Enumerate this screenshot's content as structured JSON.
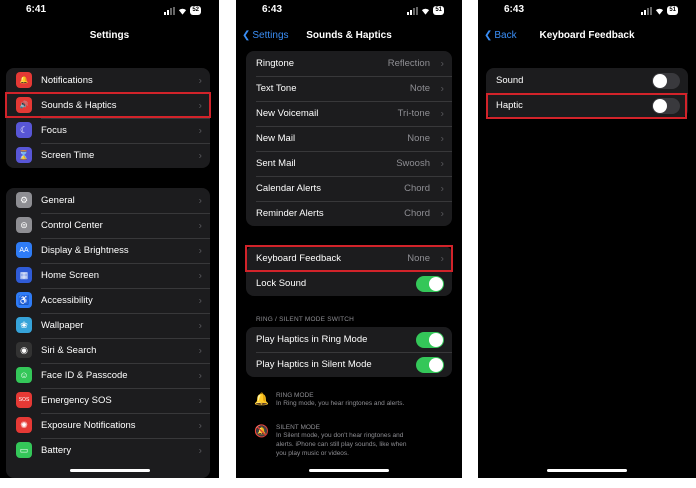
{
  "panel1": {
    "time": "6:41",
    "battery": "52",
    "title": "Settings",
    "group1": [
      {
        "label": "Notifications",
        "icon": "bell-icon",
        "color": "#e53935",
        "glyph": "🔔"
      },
      {
        "label": "Sounds & Haptics",
        "icon": "speaker-icon",
        "color": "#e53935",
        "glyph": "🔊"
      },
      {
        "label": "Focus",
        "icon": "moon-icon",
        "color": "#5856d6",
        "glyph": "☾"
      },
      {
        "label": "Screen Time",
        "icon": "hourglass-icon",
        "color": "#5856d6",
        "glyph": "⌛"
      }
    ],
    "group2": [
      {
        "label": "General",
        "icon": "gear-icon",
        "color": "#8e8e93",
        "glyph": "⚙"
      },
      {
        "label": "Control Center",
        "icon": "toggles-icon",
        "color": "#8e8e93",
        "glyph": "⊜"
      },
      {
        "label": "Display & Brightness",
        "icon": "display-icon",
        "color": "#2f7cf6",
        "glyph": "AA"
      },
      {
        "label": "Home Screen",
        "icon": "home-screen-icon",
        "color": "#2f5bd6",
        "glyph": "▦"
      },
      {
        "label": "Accessibility",
        "icon": "accessibility-icon",
        "color": "#2f7cf6",
        "glyph": "♿"
      },
      {
        "label": "Wallpaper",
        "icon": "wallpaper-icon",
        "color": "#36a3d9",
        "glyph": "❀"
      },
      {
        "label": "Siri & Search",
        "icon": "siri-icon",
        "color": "#333",
        "glyph": "◉"
      },
      {
        "label": "Face ID & Passcode",
        "icon": "face-id-icon",
        "color": "#34c759",
        "glyph": "☺"
      },
      {
        "label": "Emergency SOS",
        "icon": "sos-icon",
        "color": "#e53935",
        "glyph": "SOS"
      },
      {
        "label": "Exposure Notifications",
        "icon": "exposure-icon",
        "color": "#e53935",
        "glyph": "✺"
      },
      {
        "label": "Battery",
        "icon": "battery-icon",
        "color": "#34c759",
        "glyph": "▭"
      }
    ]
  },
  "panel2": {
    "time": "6:43",
    "battery": "51",
    "back_label": "Settings",
    "title": "Sounds & Haptics",
    "group1": [
      {
        "label": "Ringtone",
        "value": "Reflection"
      },
      {
        "label": "Text Tone",
        "value": "Note"
      },
      {
        "label": "New Voicemail",
        "value": "Tri-tone"
      },
      {
        "label": "New Mail",
        "value": "None"
      },
      {
        "label": "Sent Mail",
        "value": "Swoosh"
      },
      {
        "label": "Calendar Alerts",
        "value": "Chord"
      },
      {
        "label": "Reminder Alerts",
        "value": "Chord"
      }
    ],
    "keyboard_feedback": {
      "label": "Keyboard Feedback",
      "value": "None"
    },
    "lock_sound": {
      "label": "Lock Sound",
      "on": true
    },
    "section_header": "RING / SILENT MODE SWITCH",
    "ring_haptics": {
      "label": "Play Haptics in Ring Mode",
      "on": true
    },
    "silent_haptics": {
      "label": "Play Haptics in Silent Mode",
      "on": true
    },
    "ring_mode": {
      "title": "RING MODE",
      "desc": "In Ring mode, you hear ringtones and alerts."
    },
    "silent_mode": {
      "title": "SILENT MODE",
      "desc1": "In Silent mode, you don't hear ringtones and",
      "desc2": "alerts. iPhone can still play sounds, like when",
      "desc3": "you play music or videos."
    }
  },
  "panel3": {
    "time": "6:43",
    "battery": "51",
    "back_label": "Back",
    "title": "Keyboard Feedback",
    "sound": {
      "label": "Sound",
      "on": false
    },
    "haptic": {
      "label": "Haptic",
      "on": false
    }
  },
  "highlight_color": "#d2232a",
  "accent_color": "#3a8ef6",
  "toggle_on_color": "#34c759"
}
